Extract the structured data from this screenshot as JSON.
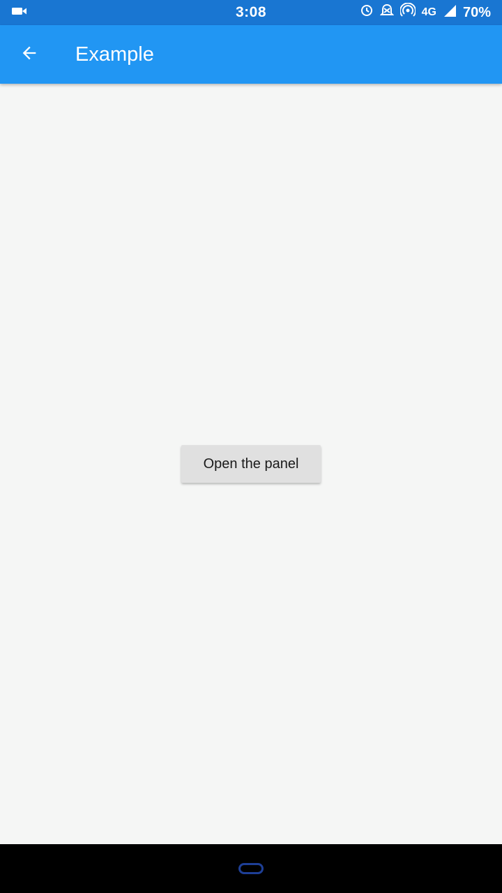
{
  "status_bar": {
    "time": "3:08",
    "network": "4G",
    "battery": "70%",
    "icons": [
      "video-camera-icon",
      "data-saver-icon",
      "alarm-off-icon",
      "hotspot-icon",
      "signal-icon"
    ]
  },
  "app_bar": {
    "title": "Example",
    "back_icon": "arrow-back-icon",
    "color": "#2196f3"
  },
  "main": {
    "button_label": "Open the panel"
  },
  "colors": {
    "status_bar": "#1976d2",
    "background": "#f5f6f5",
    "button": "#e0e0e0"
  }
}
